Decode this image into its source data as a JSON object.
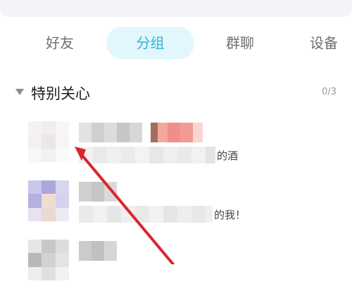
{
  "tabs": [
    {
      "label": "好友",
      "active": false
    },
    {
      "label": "分组",
      "active": true
    },
    {
      "label": "群聊",
      "active": false
    },
    {
      "label": "设备",
      "active": false
    }
  ],
  "group": {
    "title": "特别关心",
    "count": "0/3",
    "expand_icon": "triangle-down-icon"
  },
  "contacts": [
    {
      "status_suffix": "的酒"
    },
    {
      "status_suffix": "的我！"
    },
    {
      "status_suffix": ""
    }
  ],
  "colors": {
    "accent": "#2cb4d9",
    "accent_bg": "#e2f7fb",
    "annotation_arrow": "#d9262b"
  }
}
